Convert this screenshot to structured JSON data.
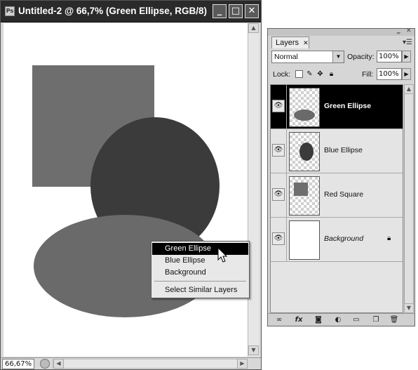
{
  "document": {
    "title": "Untitled-2 @ 66,7% (Green Ellipse, RGB/8)",
    "app_icon_label": "Ps",
    "zoom": "66,67%",
    "window_buttons": {
      "minimize": "_",
      "maximize": "□",
      "close": "✕"
    }
  },
  "canvas_shapes": [
    {
      "name": "Red Square",
      "color": "#6e6e6e"
    },
    {
      "name": "Blue Ellipse",
      "color": "#3b3b3b"
    },
    {
      "name": "Green Ellipse",
      "color": "#6a6a6a"
    }
  ],
  "context_menu": {
    "items": [
      "Green Ellipse",
      "Blue Ellipse",
      "Background"
    ],
    "selected_index": 0,
    "action": "Select Similar Layers"
  },
  "layers_panel": {
    "tab": "Layers",
    "tab_close": "✕",
    "blend_mode": "Normal",
    "opacity_label": "Opacity:",
    "opacity": "100%",
    "lock_label": "Lock:",
    "fill_label": "Fill:",
    "fill": "100%",
    "layers": [
      {
        "name": "Green Ellipse",
        "selected": true,
        "visible": true
      },
      {
        "name": "Blue Ellipse",
        "selected": false,
        "visible": true
      },
      {
        "name": "Red Square",
        "selected": false,
        "visible": true
      },
      {
        "name": "Background",
        "selected": false,
        "visible": true,
        "locked": true
      }
    ],
    "footer_icons": [
      "link-icon",
      "fx-icon",
      "mask-icon",
      "adjustment-icon",
      "group-icon",
      "new-layer-icon",
      "trash-icon"
    ],
    "fx_label": "fx"
  }
}
